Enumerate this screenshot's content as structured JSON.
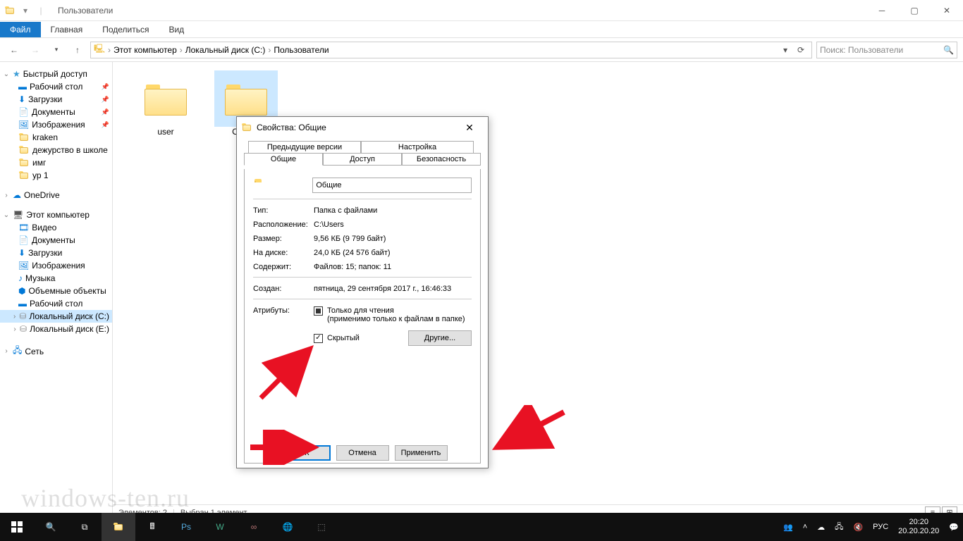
{
  "window": {
    "title": "Пользователи"
  },
  "ribbon": {
    "file": "Файл",
    "home": "Главная",
    "share": "Поделиться",
    "view": "Вид"
  },
  "breadcrumb": {
    "pc": "Этот компьютер",
    "disk": "Локальный диск (C:)",
    "folder": "Пользователи"
  },
  "search": {
    "placeholder": "Поиск: Пользователи"
  },
  "tree": {
    "quick": "Быстрый доступ",
    "desktop": "Рабочий стол",
    "downloads": "Загрузки",
    "documents": "Документы",
    "pictures": "Изображения",
    "kraken": "kraken",
    "duty": "дежурство в школе",
    "img": "имг",
    "yr1": "ур 1",
    "onedrive": "OneDrive",
    "thispc": "Этот компьютер",
    "videos": "Видео",
    "documents2": "Документы",
    "downloads2": "Загрузки",
    "pictures2": "Изображения",
    "music": "Музыка",
    "objects3d": "Объемные объекты",
    "desktop2": "Рабочий стол",
    "localc": "Локальный диск (C:)",
    "locale": "Локальный диск (E:)",
    "network": "Сеть"
  },
  "folders": {
    "user": "user",
    "public": "Общие"
  },
  "status": {
    "items": "Элементов: 2",
    "selected": "Выбран 1 элемент"
  },
  "dialog": {
    "title": "Свойства: Общие",
    "tabs": {
      "prev": "Предыдущие версии",
      "custom": "Настройка",
      "general": "Общие",
      "sharing": "Доступ",
      "security": "Безопасность"
    },
    "name": "Общие",
    "type_l": "Тип:",
    "type_v": "Папка с файлами",
    "loc_l": "Расположение:",
    "loc_v": "C:\\Users",
    "size_l": "Размер:",
    "size_v": "9,56 КБ (9 799 байт)",
    "ondisk_l": "На диске:",
    "ondisk_v": "24,0 КБ (24 576 байт)",
    "contains_l": "Содержит:",
    "contains_v": "Файлов: 15; папок: 11",
    "created_l": "Создан:",
    "created_v": "пятница, 29 сентября 2017 г., 16:46:33",
    "attr_l": "Атрибуты:",
    "readonly": "Только для чтения",
    "readonly_note": "(применимо только к файлам в папке)",
    "hidden": "Скрытый",
    "other": "Другие...",
    "ok": "ОК",
    "cancel": "Отмена",
    "apply": "Применить"
  },
  "taskbar": {
    "time": "20:20",
    "date": "20.20.20.20",
    "lang": "РУС"
  },
  "watermark": "windows-ten.ru"
}
